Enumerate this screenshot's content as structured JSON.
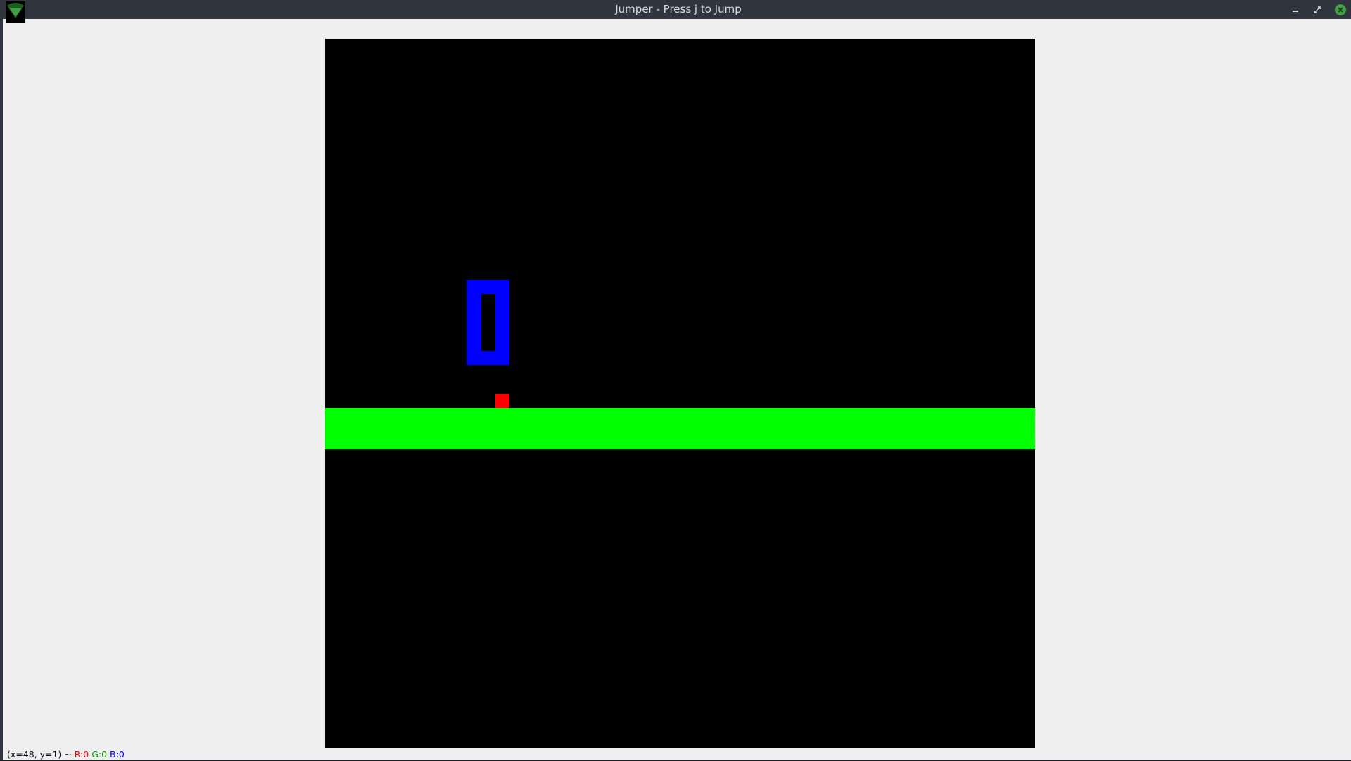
{
  "window": {
    "title": "Jumper - Press j to Jump",
    "buttons": {
      "minimize": "minimize",
      "maximize": "maximize",
      "close": "close"
    }
  },
  "colors": {
    "titlebar": "#2f343f",
    "window_bg": "#efefef",
    "canvas_bg": "#000000",
    "platform": "#00ff00",
    "obstacle": "#0000ff",
    "player": "#ff0000",
    "close_button": "#43a047",
    "status_r": "#ff0000",
    "status_g": "#00a000",
    "status_b": "#0000ff"
  },
  "icons": {
    "app": "green-triangle-icon",
    "minimize": "minimize-icon",
    "maximize": "maximize-icon",
    "close": "close-icon"
  },
  "statusbar": {
    "coords": "(x=48, y=1) ~",
    "r": "R:0",
    "g": "G:0",
    "b": "B:0"
  }
}
